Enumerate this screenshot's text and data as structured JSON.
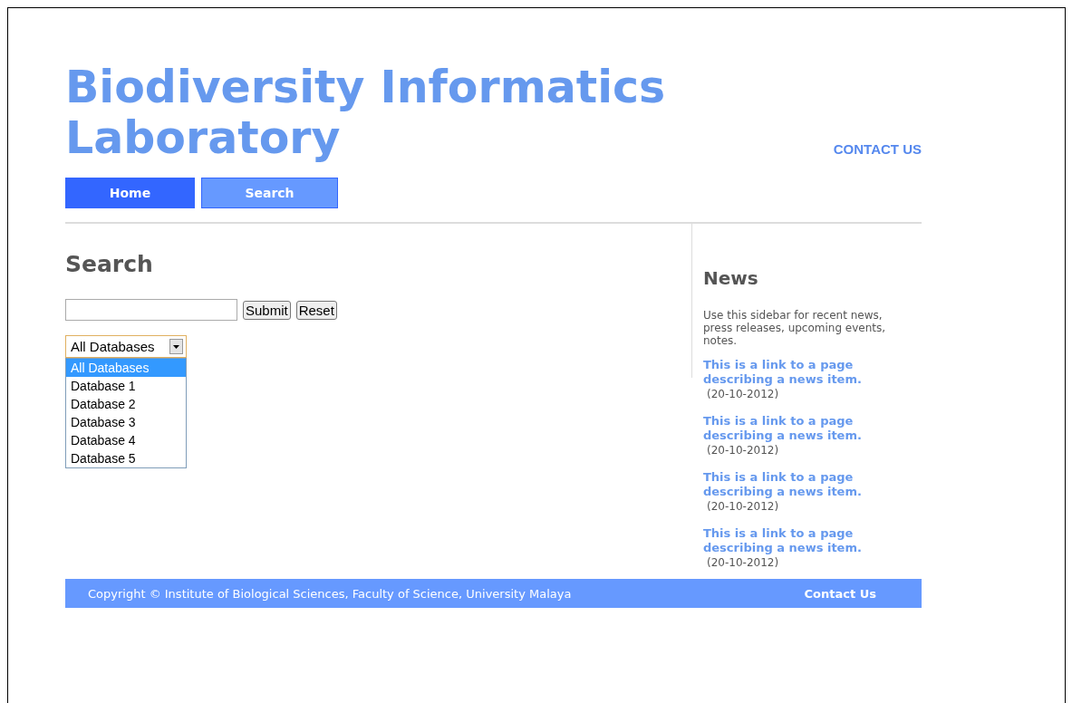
{
  "site_title": "Biodiversity Informatics Laboratory",
  "header_link": "CONTACT US",
  "nav": [
    {
      "label": "Home",
      "selected": false
    },
    {
      "label": "Search",
      "selected": true
    }
  ],
  "main": {
    "heading": "Search",
    "buttons": [
      "Submit",
      "Reset"
    ],
    "dropdown": {
      "value": "All Databases",
      "expanded": true,
      "options": [
        {
          "label": "All Databases",
          "selected": true
        },
        {
          "label": "Database 1",
          "selected": false
        },
        {
          "label": "Database 2",
          "selected": false
        },
        {
          "label": "Database 3",
          "selected": false
        },
        {
          "label": "Database 4",
          "selected": false
        },
        {
          "label": "Database 5",
          "selected": false
        }
      ]
    }
  },
  "sidebar": {
    "heading": "News",
    "intro": "Use this sidebar for recent news, press releases, upcoming events, notes.",
    "items": [
      {
        "link": "This is a link to a page describing a news item.",
        "date": "(20-10-2012)"
      },
      {
        "link": "This is a link to a page describing a news item.",
        "date": "(20-10-2012)"
      },
      {
        "link": "This is a link to a page describing a news item.",
        "date": "(20-10-2012)"
      },
      {
        "link": "This is a link to a page describing a news item.",
        "date": "(20-10-2012)"
      }
    ]
  },
  "footer": {
    "copyright": "Copyright © Institute of Biological Sciences, Faculty of Science, University Malaya",
    "link": "Contact Us"
  }
}
